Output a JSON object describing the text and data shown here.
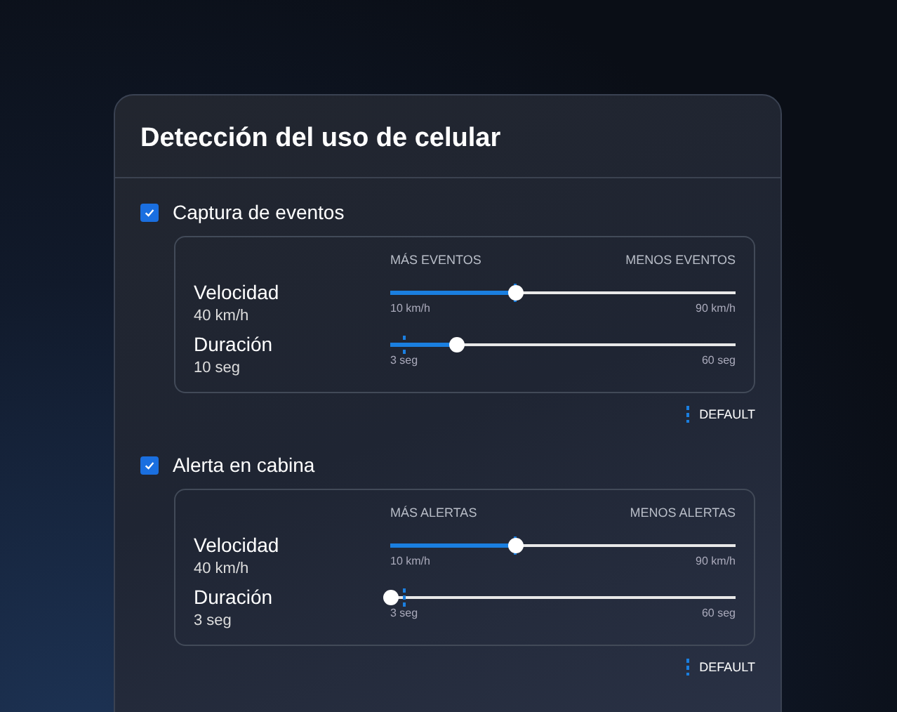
{
  "panel": {
    "title": "Detección del uso de celular"
  },
  "sections": [
    {
      "label": "Captura de eventos",
      "checked": true,
      "scale_left": "MÁS EVENTOS",
      "scale_right": "MENOS EVENTOS",
      "default_label": "DEFAULT",
      "sliders": [
        {
          "name": "Velocidad",
          "reading": "40 km/h",
          "level": 0.36,
          "default": {
            "level": 0.36
          },
          "min": "10 km/h",
          "max": "90 km/h"
        },
        {
          "name": "Duración",
          "reading": "10 seg",
          "level": 0.19,
          "default": {
            "level": 0.04
          },
          "min": "3 seg",
          "max": "60 seg"
        }
      ]
    },
    {
      "label": "Alerta en cabina",
      "checked": true,
      "scale_left": "MÁS ALERTAS",
      "scale_right": "MENOS ALERTAS",
      "default_label": "DEFAULT",
      "sliders": [
        {
          "name": "Velocidad",
          "reading": "40 km/h",
          "level": 0.36,
          "default": {
            "level": 0.36
          },
          "min": "10 km/h",
          "max": "90 km/h"
        },
        {
          "name": "Duración",
          "reading": "3 seg",
          "level": 0,
          "default": {
            "level": 0.04
          },
          "min": "3 seg",
          "max": "60 seg"
        }
      ]
    }
  ]
}
